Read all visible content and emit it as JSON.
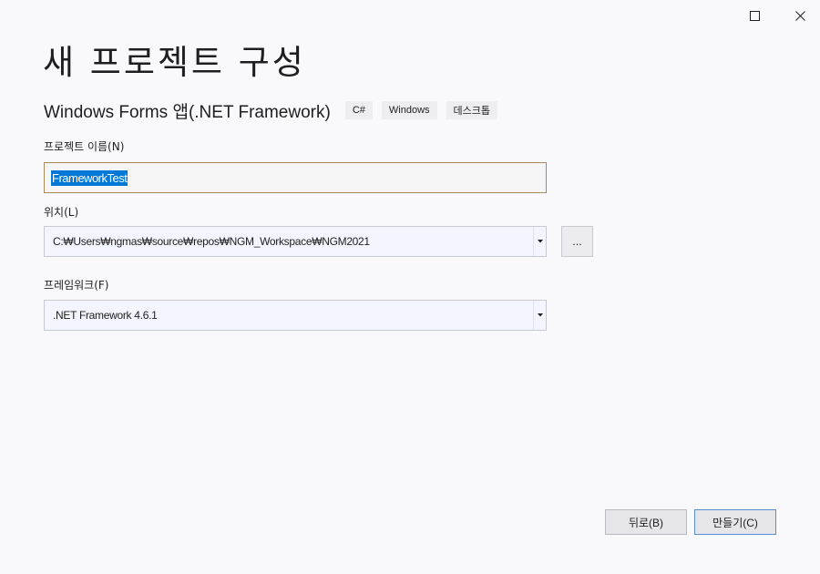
{
  "window": {
    "maximize_icon": "maximize-icon",
    "close_icon": "close-icon"
  },
  "page": {
    "title": "새 프로젝트 구성"
  },
  "template": {
    "name": "Windows Forms 앱(.NET Framework)",
    "tags": [
      "C#",
      "Windows",
      "데스크톱"
    ]
  },
  "form": {
    "project_name_label": "프로젝트 이름(N)",
    "project_name_value": "FrameworkTest",
    "location_label": "위치(L)",
    "location_value": "C:₩Users₩ngmas₩source₩repos₩NGM_Workspace₩NGM2021",
    "browse_label": "...",
    "framework_label": "프레임워크(F)",
    "framework_value": ".NET Framework 4.6.1"
  },
  "footer": {
    "back_label": "뒤로(B)",
    "create_label": "만들기(C)"
  },
  "colors": {
    "selection": "#0078d7",
    "focus_border": "#a88a5a",
    "primary_border": "#5a8fd6"
  }
}
